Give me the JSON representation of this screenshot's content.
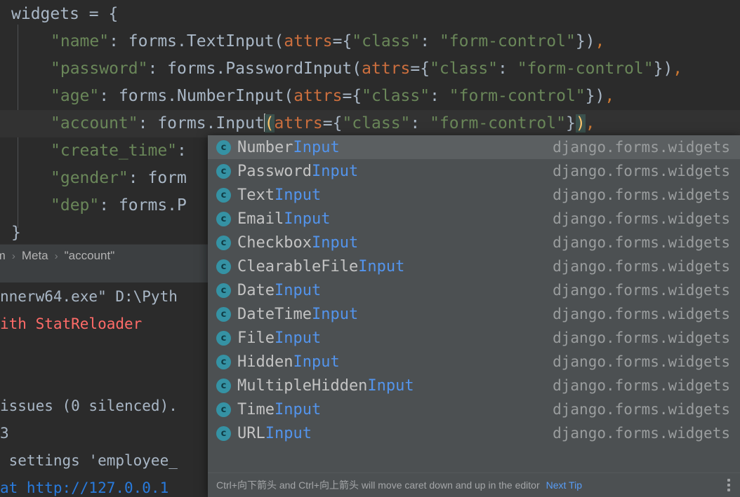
{
  "editor": {
    "lines": [
      {
        "indent": 0,
        "segments": [
          {
            "t": "widgets = {",
            "c": "c-def"
          }
        ]
      },
      {
        "indent": 1,
        "segments": [
          {
            "t": "\"name\"",
            "c": "c-str"
          },
          {
            "t": ": forms.TextInput(",
            "c": "c-def"
          },
          {
            "t": "attrs",
            "c": "c-kwarg"
          },
          {
            "t": "={",
            "c": "c-def"
          },
          {
            "t": "\"class\"",
            "c": "c-str"
          },
          {
            "t": ": ",
            "c": "c-def"
          },
          {
            "t": "\"form-control\"",
            "c": "c-str"
          },
          {
            "t": "})",
            "c": "c-def"
          },
          {
            "t": ",",
            "c": "c-comma"
          }
        ]
      },
      {
        "indent": 1,
        "segments": [
          {
            "t": "\"password\"",
            "c": "c-str"
          },
          {
            "t": ": forms.PasswordInput(",
            "c": "c-def"
          },
          {
            "t": "attrs",
            "c": "c-kwarg"
          },
          {
            "t": "={",
            "c": "c-def"
          },
          {
            "t": "\"class\"",
            "c": "c-str"
          },
          {
            "t": ": ",
            "c": "c-def"
          },
          {
            "t": "\"form-control\"",
            "c": "c-str"
          },
          {
            "t": "})",
            "c": "c-def"
          },
          {
            "t": ",",
            "c": "c-comma"
          }
        ]
      },
      {
        "indent": 1,
        "segments": [
          {
            "t": "\"age\"",
            "c": "c-str"
          },
          {
            "t": ": forms.NumberInput(",
            "c": "c-def"
          },
          {
            "t": "attrs",
            "c": "c-kwarg"
          },
          {
            "t": "={",
            "c": "c-def"
          },
          {
            "t": "\"class\"",
            "c": "c-str"
          },
          {
            "t": ": ",
            "c": "c-def"
          },
          {
            "t": "\"form-control\"",
            "c": "c-str"
          },
          {
            "t": "})",
            "c": "c-def"
          },
          {
            "t": ",",
            "c": "c-comma"
          }
        ]
      },
      {
        "indent": 1,
        "segments": [
          {
            "t": "\"account\"",
            "c": "c-str"
          },
          {
            "t": ": forms.Input",
            "c": "c-def"
          },
          {
            "t": "CARET",
            "c": "caret"
          },
          {
            "t": "(",
            "c": "c-paren-hl"
          },
          {
            "t": "attrs",
            "c": "c-kwarg"
          },
          {
            "t": "={",
            "c": "c-def"
          },
          {
            "t": "\"class\"",
            "c": "c-str"
          },
          {
            "t": ": ",
            "c": "c-def"
          },
          {
            "t": "\"form-control\"",
            "c": "c-str"
          },
          {
            "t": "}",
            "c": "c-def"
          },
          {
            "t": ")",
            "c": "c-paren-hl"
          },
          {
            "t": ",",
            "c": "c-comma"
          }
        ]
      },
      {
        "indent": 1,
        "segments": [
          {
            "t": "\"create_time\"",
            "c": "c-str"
          },
          {
            "t": ":",
            "c": "c-def"
          }
        ]
      },
      {
        "indent": 1,
        "segments": [
          {
            "t": "\"gender\"",
            "c": "c-str"
          },
          {
            "t": ": form",
            "c": "c-def"
          }
        ]
      },
      {
        "indent": 1,
        "segments": [
          {
            "t": "\"dep\"",
            "c": "c-str"
          },
          {
            "t": ": forms.P",
            "c": "c-def"
          }
        ]
      },
      {
        "indent": 0,
        "segments": [
          {
            "t": "}",
            "c": "c-def"
          }
        ]
      }
    ]
  },
  "breadcrumb": {
    "items": [
      "rm",
      "Meta",
      "\"account\""
    ]
  },
  "console": {
    "lines": [
      {
        "text": "nnerw64.exe\" D:\\Pyth",
        "cls": "con-default"
      },
      {
        "text": "ith StatReloader",
        "cls": "con-err"
      },
      {
        "text": "",
        "cls": "con-default"
      },
      {
        "text": "",
        "cls": "con-default"
      },
      {
        "text": "issues (0 silenced).",
        "cls": "con-default"
      },
      {
        "text": "3",
        "cls": "con-default"
      },
      {
        "text": " settings 'employee_",
        "cls": "con-default"
      },
      {
        "text": "at http://127.0.0.1",
        "cls": "con-link"
      }
    ]
  },
  "completion_popup": {
    "origin_label": "django.forms.widgets",
    "icon_glyph": "c",
    "selected_index": 0,
    "items": [
      {
        "prefix": "Number",
        "match": "Input",
        "origin": "django.forms.widgets"
      },
      {
        "prefix": "Password",
        "match": "Input",
        "origin": "django.forms.widgets"
      },
      {
        "prefix": "Text",
        "match": "Input",
        "origin": "django.forms.widgets"
      },
      {
        "prefix": "Email",
        "match": "Input",
        "origin": "django.forms.widgets"
      },
      {
        "prefix": "Checkbox",
        "match": "Input",
        "origin": "django.forms.widgets"
      },
      {
        "prefix": "ClearableFile",
        "match": "Input",
        "origin": "django.forms.widgets"
      },
      {
        "prefix": "Date",
        "match": "Input",
        "origin": "django.forms.widgets"
      },
      {
        "prefix": "DateTime",
        "match": "Input",
        "origin": "django.forms.widgets"
      },
      {
        "prefix": "File",
        "match": "Input",
        "origin": "django.forms.widgets"
      },
      {
        "prefix": "Hidden",
        "match": "Input",
        "origin": "django.forms.widgets"
      },
      {
        "prefix": "MultipleHidden",
        "match": "Input",
        "origin": "django.forms.widgets"
      },
      {
        "prefix": "Time",
        "match": "Input",
        "origin": "django.forms.widgets"
      },
      {
        "prefix": "URL",
        "match": "Input",
        "origin": "django.forms.widgets"
      }
    ],
    "footer": {
      "tip_text": "Ctrl+向下箭头 and Ctrl+向上箭头 will move caret down and up in the editor",
      "next_tip_label": "Next Tip"
    }
  },
  "colors": {
    "editor_bg": "#2b2b2b",
    "caret_line_bg": "#323232",
    "popup_bg": "#4c5052",
    "popup_selected_bg": "#5b5f61",
    "string_green": "#6a8759",
    "kwarg_orange": "#cc6f3e",
    "match_blue": "#5394ec",
    "link_blue": "#589df6",
    "error_red": "#ff6b68",
    "icon_teal": "#3592a4"
  }
}
